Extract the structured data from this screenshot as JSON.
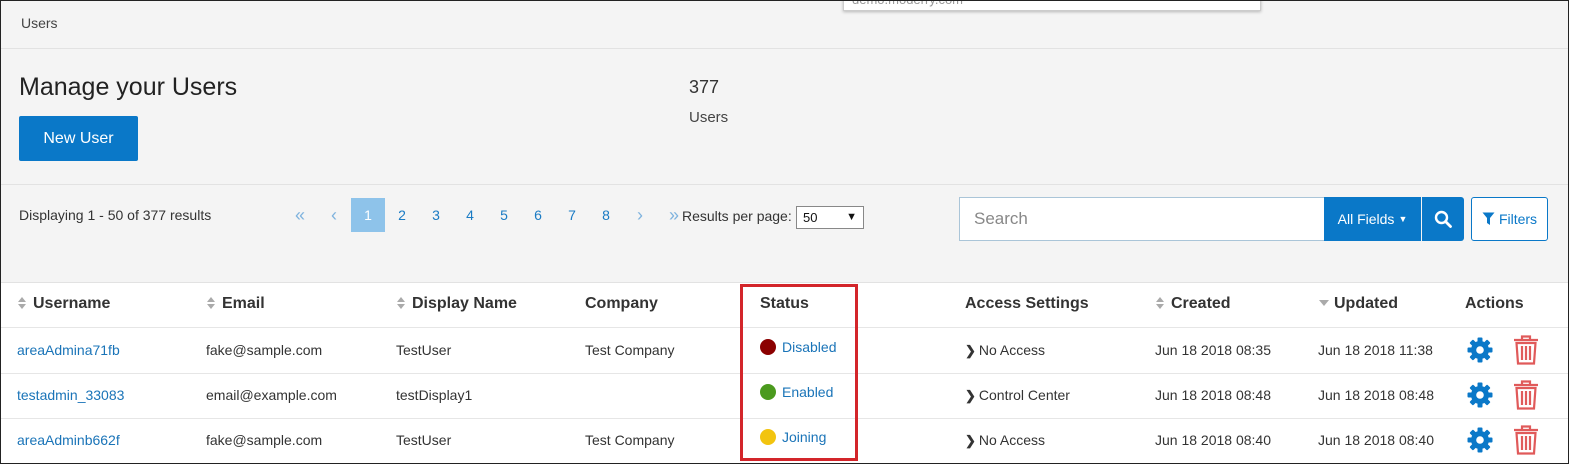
{
  "popup": {
    "text": "demo.moderry.com"
  },
  "breadcrumb": "Users",
  "header": {
    "title": "Manage your Users",
    "new_user_label": "New User",
    "count": "377",
    "count_label": "Users"
  },
  "toolbar": {
    "displaying": "Displaying 1 - 50 of 377 results",
    "pages": [
      "1",
      "2",
      "3",
      "4",
      "5",
      "6",
      "7",
      "8"
    ],
    "active_page": "1",
    "results_per_page_label": "Results per page:",
    "results_per_page": "50",
    "search_placeholder": "Search",
    "all_fields_label": "All Fields",
    "filters_label": "Filters"
  },
  "table": {
    "headers": {
      "username": "Username",
      "email": "Email",
      "display_name": "Display Name",
      "company": "Company",
      "status": "Status",
      "access": "Access Settings",
      "created": "Created",
      "updated": "Updated",
      "actions": "Actions"
    },
    "rows": [
      {
        "username": "areaAdmina71fb",
        "email": "fake@sample.com",
        "display_name": "TestUser",
        "company": "Test Company",
        "status": "Disabled",
        "status_color": "#8b0000",
        "access": "No Access",
        "created": "Jun 18 2018 08:35",
        "updated": "Jun 18 2018 11:38"
      },
      {
        "username": "testadmin_33083",
        "email": "email@example.com",
        "display_name": "testDisplay1",
        "company": "",
        "status": "Enabled",
        "status_color": "#4b9a1e",
        "access": "Control Center",
        "created": "Jun 18 2018 08:48",
        "updated": "Jun 18 2018 08:48"
      },
      {
        "username": "areaAdminb662f",
        "email": "fake@sample.com",
        "display_name": "TestUser",
        "company": "Test Company",
        "status": "Joining",
        "status_color": "#f2c40f",
        "access": "No Access",
        "created": "Jun 18 2018 08:40",
        "updated": "Jun 18 2018 08:40"
      }
    ]
  },
  "colors": {
    "primary": "#0a78c8",
    "link": "#1a74b8",
    "delete": "#e05a5a",
    "highlight": "#d3252a"
  }
}
